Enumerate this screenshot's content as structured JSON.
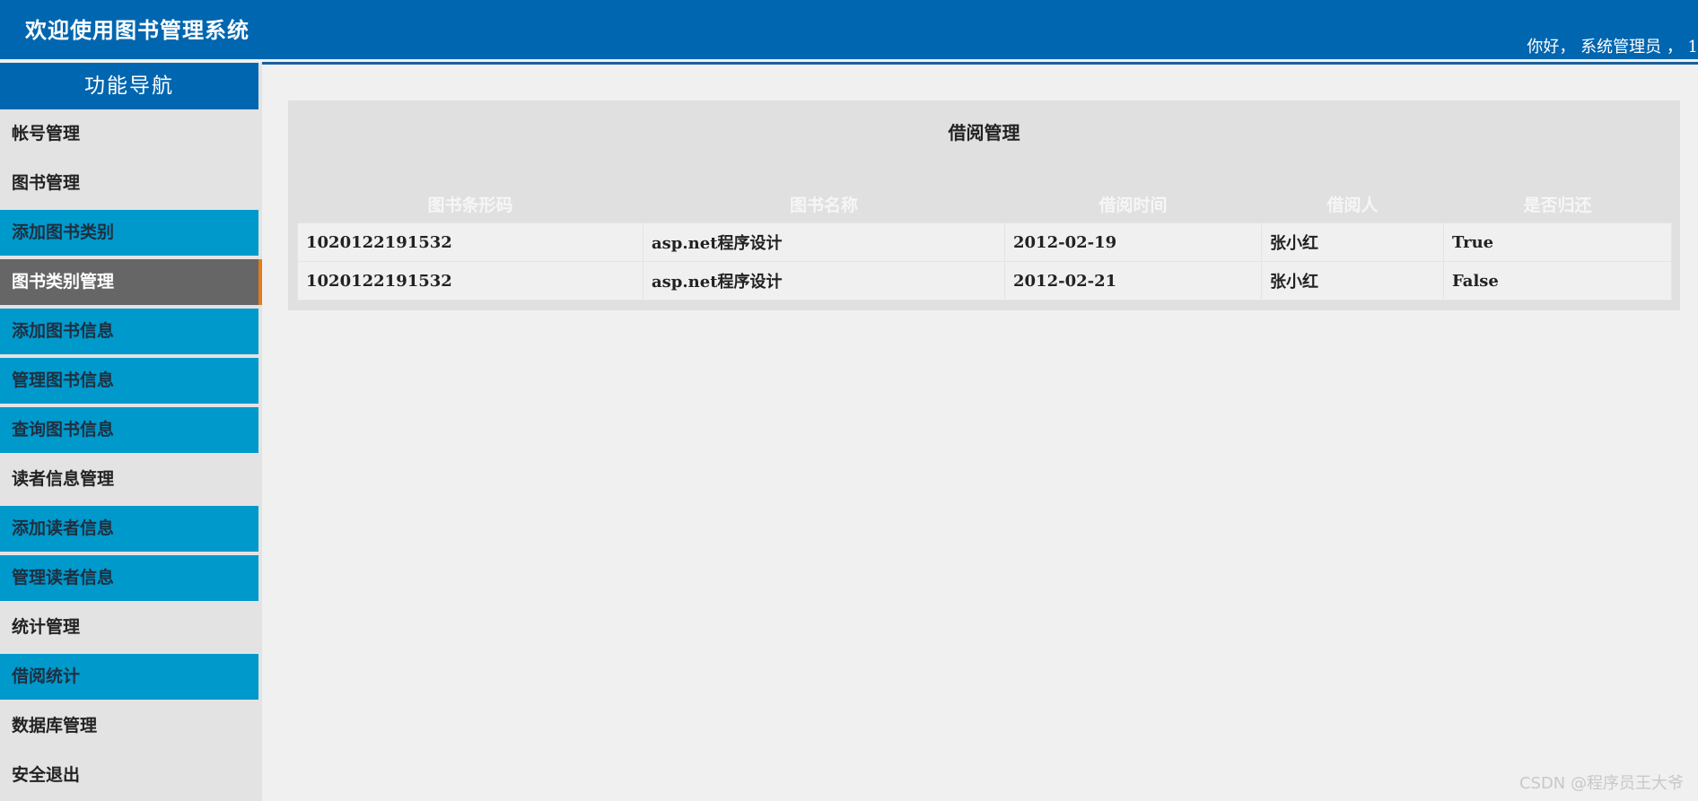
{
  "header": {
    "title": "欢迎使用图书管理系统",
    "user_greeting": "你好， 系统管理员 ， 1"
  },
  "sidebar": {
    "title": "功能导航",
    "items": [
      {
        "label": "帐号管理",
        "kind": "group"
      },
      {
        "label": "图书管理",
        "kind": "group"
      },
      {
        "label": "添加图书类别",
        "kind": "sub"
      },
      {
        "label": "图书类别管理",
        "kind": "active"
      },
      {
        "label": "添加图书信息",
        "kind": "sub"
      },
      {
        "label": "管理图书信息",
        "kind": "sub"
      },
      {
        "label": "查询图书信息",
        "kind": "sub"
      },
      {
        "label": "读者信息管理",
        "kind": "group"
      },
      {
        "label": "添加读者信息",
        "kind": "sub"
      },
      {
        "label": "管理读者信息",
        "kind": "sub"
      },
      {
        "label": "统计管理",
        "kind": "group"
      },
      {
        "label": "借阅统计",
        "kind": "sub"
      },
      {
        "label": "数据库管理",
        "kind": "group"
      },
      {
        "label": "安全退出",
        "kind": "group"
      }
    ]
  },
  "main": {
    "panel_title": "借阅管理",
    "table": {
      "columns": [
        "图书条形码",
        "图书名称",
        "借阅时间",
        "借阅人",
        "是否归还"
      ],
      "rows": [
        [
          "1020122191532",
          "asp.net程序设计",
          "2012-02-19",
          "张小红",
          "True"
        ],
        [
          "1020122191532",
          "asp.net程序设计",
          "2012-02-21",
          "张小红",
          "False"
        ]
      ]
    }
  },
  "watermark": "CSDN @程序员王大爷",
  "colors": {
    "header_bg": "#0066b0",
    "nav_sub_bg": "#0099cc",
    "nav_active_bg": "#666666",
    "nav_active_accent": "#e77a1a"
  }
}
